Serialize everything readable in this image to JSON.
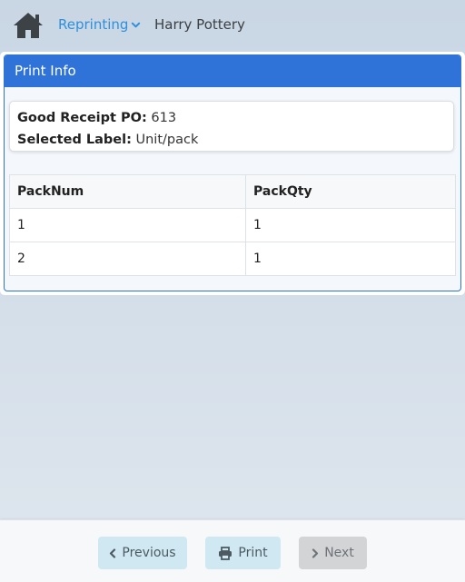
{
  "header": {
    "home_icon": "home-icon",
    "menu_label": "Reprinting",
    "user_name": "Harry Pottery",
    "accent_color": "#2f8fdb"
  },
  "card": {
    "title": "Print Info",
    "header_color": "#2f73d9",
    "info": {
      "po_label": "Good Receipt PO:",
      "po_value": "613",
      "label_label": "Selected Label:",
      "label_value": "Unit/pack"
    },
    "table": {
      "columns": [
        "PackNum",
        "PackQty"
      ],
      "rows": [
        [
          "1",
          "1"
        ],
        [
          "2",
          "1"
        ]
      ]
    }
  },
  "footer": {
    "previous_label": "Previous",
    "print_label": "Print",
    "next_label": "Next"
  }
}
